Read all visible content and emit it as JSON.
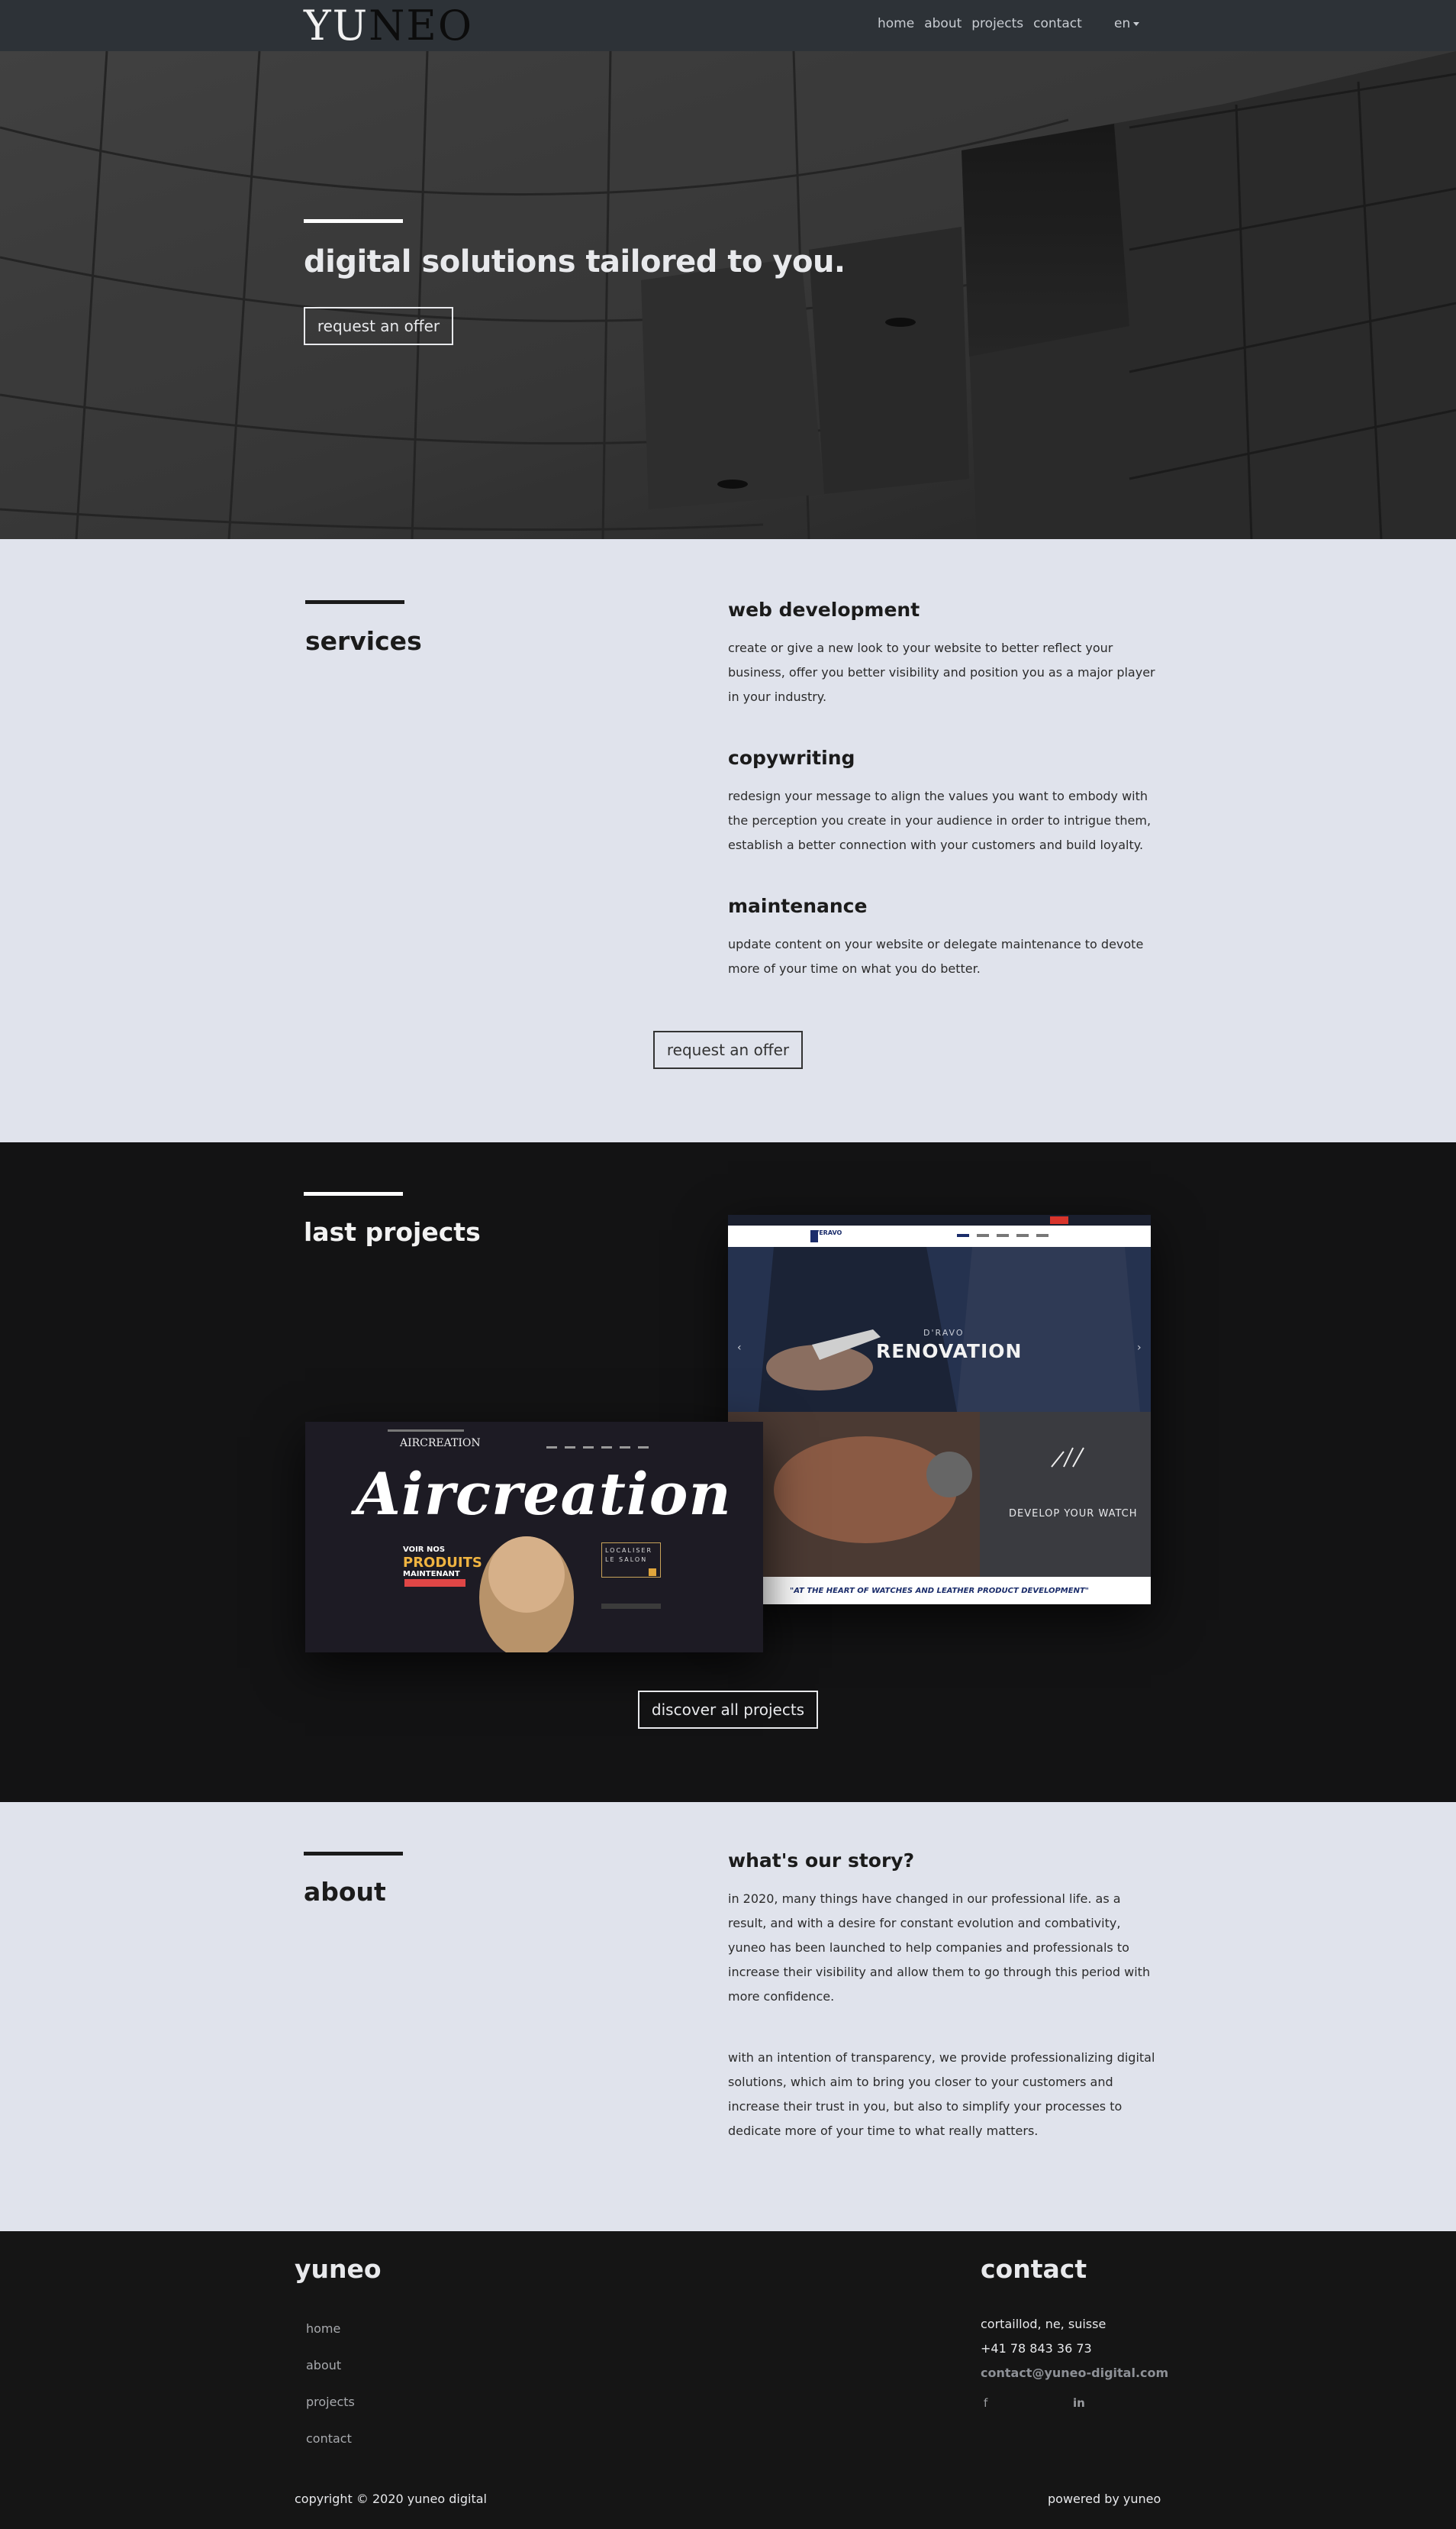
{
  "nav": {
    "logo": "YUNEO",
    "links": [
      "home",
      "about",
      "projects",
      "contact"
    ],
    "language": "en"
  },
  "hero": {
    "headline": "digital solutions tailored to you.",
    "cta": "request an offer"
  },
  "services": {
    "title": "services",
    "items": [
      {
        "title": "web development",
        "text": "create or give a new look to your website to better reflect your business, offer you better visibility and position you as a major player in your industry."
      },
      {
        "title": "copywriting",
        "text": "redesign your message to align the values you want to embody with the perception you create in your audience in order to intrigue them, establish a better connection with your customers and build loyalty."
      },
      {
        "title": "maintenance",
        "text": "update content on your website or delegate maintenance to devote more of your time on what you do better."
      }
    ],
    "cta": "request an offer"
  },
  "projects": {
    "title": "last projects",
    "cta": "discover all projects",
    "card1": {
      "brand": "VERAVO",
      "overlay_small": "D'RAVO",
      "overlay_big": "RENOVATION",
      "develop": "DEVELOP YOUR WATCH",
      "tagline": "\"AT THE HEART OF WATCHES AND LEATHER PRODUCT DEVELOPMENT\""
    },
    "card2": {
      "brand": "AIRCREATION",
      "big": "Aircreation",
      "line1": "VOIR NOS",
      "line2": "PRODUITS",
      "line3": "MAINTENANT",
      "box": "LOCALISER LE SALON"
    }
  },
  "about": {
    "title": "about",
    "heading": "what's our story?",
    "para1": "in 2020, many things have changed in our professional life. as a result, and with a desire for constant evolution and combativity, yuneo has been launched to help companies and professionals to increase their visibility and allow them to go through this period with more confidence.",
    "para2": "with an intention of transparency, we provide professionalizing digital solutions, which aim to bring you closer to your customers and increase their trust in you, but also to simplify your processes to dedicate more of your time to what really matters."
  },
  "footer": {
    "brand": "yuneo",
    "links": [
      "home",
      "about",
      "projects",
      "contact"
    ],
    "contact_title": "contact",
    "address": "cortaillod, ne, suisse",
    "phone": "+41 78 843 36 73",
    "email": "contact@yuneo-digital.com",
    "social": [
      "f",
      "in"
    ],
    "copyright": "copyright © 2020 yuneo digital",
    "powered": "powered by yuneo"
  },
  "colors": {
    "nav_bg": "#2d3237",
    "light_bg": "#e0e3ec",
    "dark_bg": "#131314",
    "footer_bg": "#151515"
  }
}
